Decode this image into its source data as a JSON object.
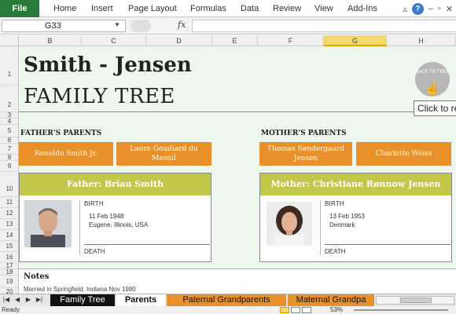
{
  "ribbon": {
    "file": "File",
    "tabs": [
      "Home",
      "Insert",
      "Page Layout",
      "Formulas",
      "Data",
      "Review",
      "View",
      "Add-Ins"
    ],
    "help_glyph": "?",
    "icons": [
      "ribbon-collapse-icon",
      "help-icon",
      "minimize-icon",
      "restore-icon",
      "close-icon"
    ]
  },
  "formula_bar": {
    "name_box": "G33",
    "fx": "fx",
    "value": ""
  },
  "columns": [
    "B",
    "C",
    "D",
    "E",
    "F",
    "G",
    "H"
  ],
  "selected_column": "G",
  "rows": [
    "1",
    "2",
    "3",
    "4",
    "5",
    "6",
    "7",
    "8",
    "9",
    "10",
    "11",
    "12",
    "13",
    "14",
    "15",
    "16",
    "17",
    "18",
    "19",
    "20"
  ],
  "sheet": {
    "title_name": "Smith - Jensen",
    "title_sub": "FAMILY TREE",
    "back_button": "BACK TO TREE",
    "tooltip": "Click to re",
    "fathers_parents_label": "FATHER'S PARENTS",
    "mothers_parents_label": "MOTHER'S PARENTS",
    "grandparents": {
      "paternal_grandfather": "Ronaldo Smith Jr.",
      "paternal_grandmother": "Laure Goudiard du Mesnil",
      "maternal_grandfather": "Thomas Søndergaard Jensen",
      "maternal_grandmother": "Charlotte Weiss"
    },
    "father": {
      "header": "Father: Brian Smith",
      "birth_label": "BIRTH",
      "birth_date": "11 Feb 1948",
      "birth_place": "Eugene, Illinois, USA",
      "death_label": "DEATH"
    },
    "mother": {
      "header": "Mother: Christiane Rønnow Jensen",
      "birth_label": "BIRTH",
      "birth_date": "13 Feb 1953",
      "birth_place": "Denmark",
      "death_label": "DEATH"
    },
    "notes_title": "Notes",
    "notes_text": "Married in Springfield, Indiana Nov 1980"
  },
  "sheet_tabs": [
    {
      "label": "Family Tree",
      "style": "dark"
    },
    {
      "label": "Parents",
      "style": "active"
    },
    {
      "label": "Paternal Grandparents",
      "style": "orange"
    },
    {
      "label": "Maternal Grandpa",
      "style": "orange"
    }
  ],
  "status": {
    "text": "Ready",
    "zoom": "53%"
  },
  "colors": {
    "file_tab": "#2a7a3a",
    "grandparent_box": "#e8912a",
    "parent_header": "#c2c74a",
    "sheet_background": "#eef7ee",
    "selected_column": "#f5d96b"
  }
}
